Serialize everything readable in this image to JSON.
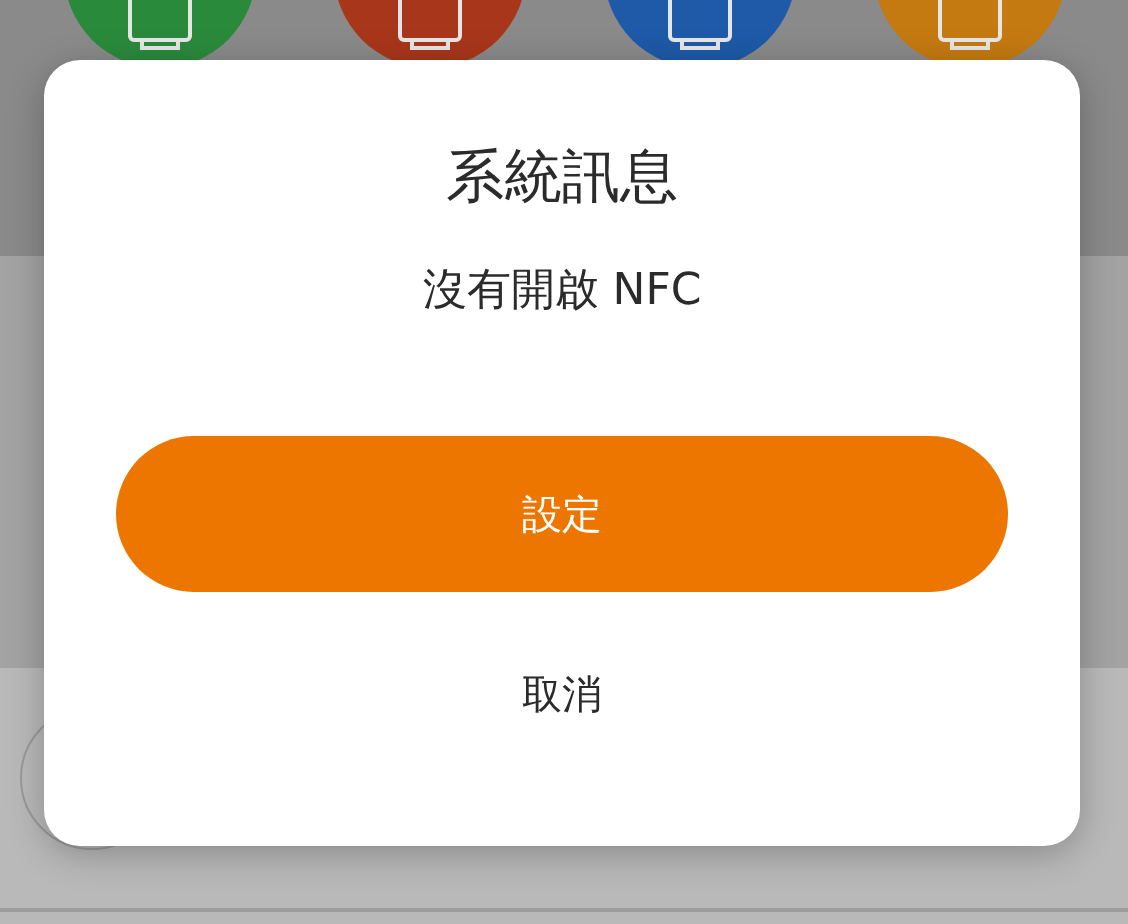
{
  "dialog": {
    "title": "系統訊息",
    "message": "沒有開啟 NFC",
    "buttons": [
      {
        "label": "設定",
        "kind": "primary"
      },
      {
        "label": "取消",
        "kind": "text"
      }
    ]
  }
}
